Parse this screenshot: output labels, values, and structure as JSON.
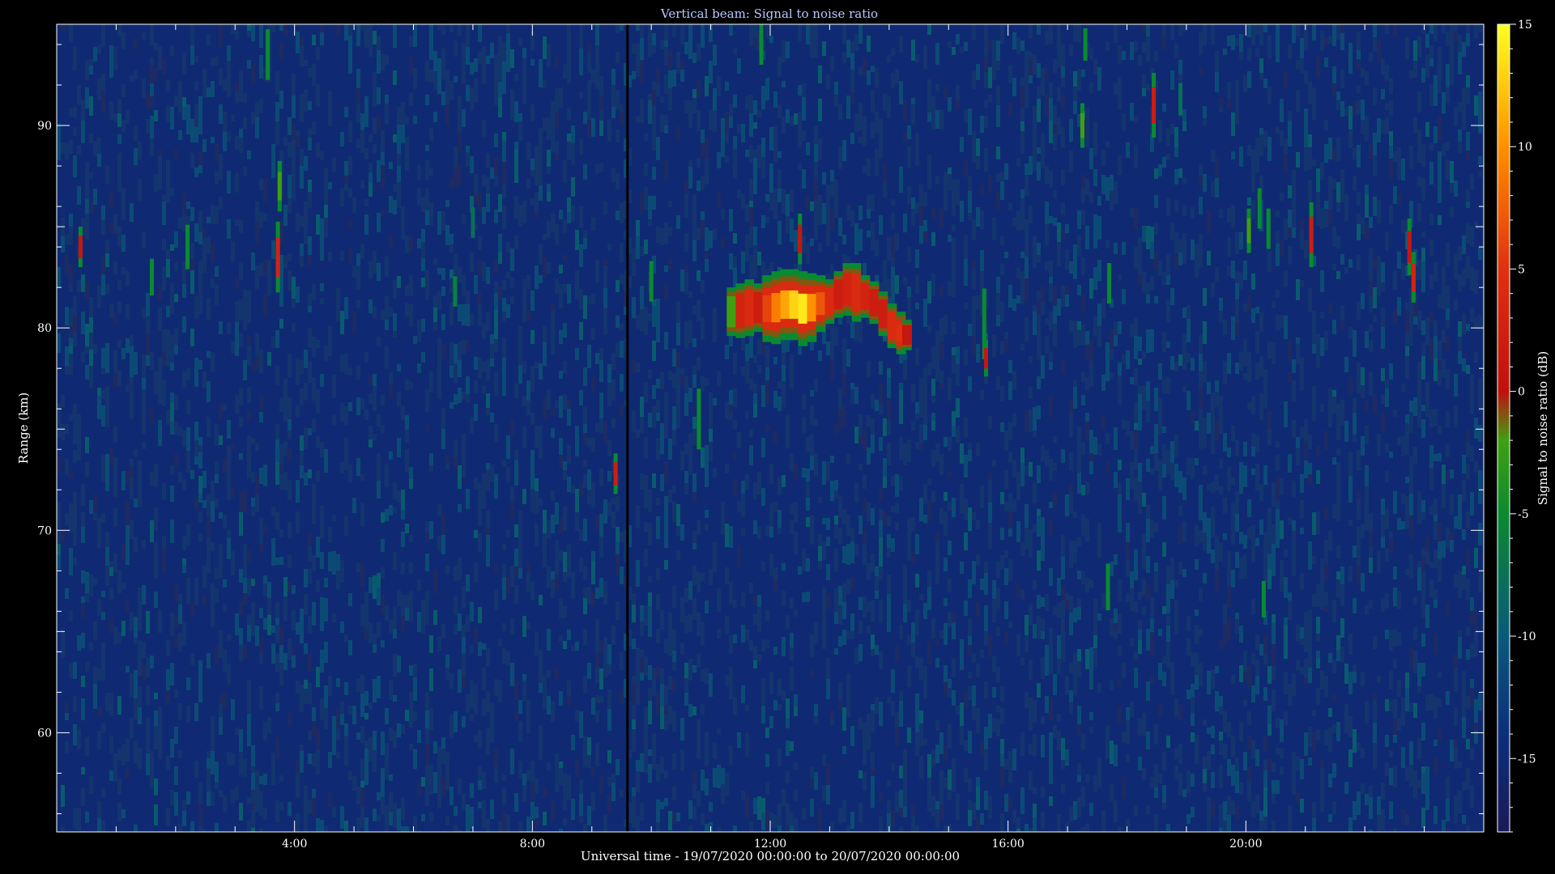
{
  "chart_data": {
    "type": "heatmap",
    "title": "Vertical beam: Signal to noise ratio",
    "xlabel": "Universal time - 19/07/2020 00:00:00 to 20/07/2020 00:00:00",
    "ylabel": "Range (km)",
    "colorbar_label": "Signal to noise ratio (dB)",
    "xlim_hours": [
      0,
      24
    ],
    "ylim_km": [
      55.1,
      95.0
    ],
    "x_ticks": [
      {
        "hour": 4,
        "label": "4:00"
      },
      {
        "hour": 8,
        "label": "8:00"
      },
      {
        "hour": 12,
        "label": "12:00"
      },
      {
        "hour": 16,
        "label": "16:00"
      },
      {
        "hour": 20,
        "label": "20:00"
      }
    ],
    "y_ticks": [
      {
        "km": 60,
        "label": "60"
      },
      {
        "km": 70,
        "label": "70"
      },
      {
        "km": 80,
        "label": "80"
      },
      {
        "km": 90,
        "label": "90"
      }
    ],
    "colorbar_range_db": [
      -18,
      15
    ],
    "colorbar_ticks": [
      {
        "db": 15,
        "label": "15"
      },
      {
        "db": 10,
        "label": "10"
      },
      {
        "db": 5,
        "label": "5"
      },
      {
        "db": 0,
        "label": "0"
      },
      {
        "db": -5,
        "label": "-5"
      },
      {
        "db": -10,
        "label": "-10"
      },
      {
        "db": -15,
        "label": "-15"
      }
    ],
    "colormap_stops": [
      {
        "db": -18,
        "color": "#1a1a5a"
      },
      {
        "db": -14,
        "color": "#0b2f7a"
      },
      {
        "db": -10,
        "color": "#0a5a7a"
      },
      {
        "db": -5,
        "color": "#0a8a30"
      },
      {
        "db": -2,
        "color": "#40a010"
      },
      {
        "db": 0,
        "color": "#c01010"
      },
      {
        "db": 5,
        "color": "#e03010"
      },
      {
        "db": 10,
        "color": "#ff9000"
      },
      {
        "db": 15,
        "color": "#ffff20"
      }
    ],
    "background_db": -15,
    "data_gap_hour": 9.6,
    "echoes": [
      {
        "hour": 0.4,
        "km": 84.0,
        "height_km": 2.0,
        "db": 1
      },
      {
        "hour": 2.2,
        "km": 84.0,
        "height_km": 2.2,
        "db": -5
      },
      {
        "hour": 1.6,
        "km": 82.5,
        "height_km": 1.8,
        "db": -5
      },
      {
        "hour": 3.55,
        "km": 93.5,
        "height_km": 2.5,
        "db": -5
      },
      {
        "hour": 3.75,
        "km": 87.0,
        "height_km": 2.5,
        "db": -2
      },
      {
        "hour": 3.72,
        "km": 83.5,
        "height_km": 3.5,
        "db": 3
      },
      {
        "hour": 6.7,
        "km": 81.8,
        "height_km": 1.5,
        "db": -6
      },
      {
        "hour": 7.0,
        "km": 85.2,
        "height_km": 1.5,
        "db": -8
      },
      {
        "hour": 9.4,
        "km": 72.8,
        "height_km": 2.0,
        "db": 2
      },
      {
        "hour": 10.0,
        "km": 82.3,
        "height_km": 2.0,
        "db": -5
      },
      {
        "hour": 10.8,
        "km": 75.5,
        "height_km": 3.0,
        "db": -5
      },
      {
        "hour": 11.85,
        "km": 94.0,
        "height_km": 2.0,
        "db": -5
      },
      {
        "hour": 12.5,
        "km": 84.4,
        "height_km": 2.5,
        "db": 1
      },
      {
        "hour": 15.6,
        "km": 80.2,
        "height_km": 3.5,
        "db": -5
      },
      {
        "hour": 15.63,
        "km": 78.5,
        "height_km": 1.8,
        "db": 1
      },
      {
        "hour": 17.3,
        "km": 94.0,
        "height_km": 1.6,
        "db": -5
      },
      {
        "hour": 17.25,
        "km": 90.0,
        "height_km": 2.2,
        "db": -2
      },
      {
        "hour": 17.7,
        "km": 82.2,
        "height_km": 2.0,
        "db": -5
      },
      {
        "hour": 17.68,
        "km": 67.2,
        "height_km": 2.3,
        "db": -5
      },
      {
        "hour": 18.45,
        "km": 91.0,
        "height_km": 3.2,
        "db": 2
      },
      {
        "hour": 18.9,
        "km": 91.3,
        "height_km": 1.6,
        "db": -8
      },
      {
        "hour": 20.05,
        "km": 84.8,
        "height_km": 2.2,
        "db": -2
      },
      {
        "hour": 20.23,
        "km": 85.9,
        "height_km": 2.0,
        "db": -5
      },
      {
        "hour": 20.38,
        "km": 84.9,
        "height_km": 2.0,
        "db": -5
      },
      {
        "hour": 20.3,
        "km": 66.6,
        "height_km": 1.8,
        "db": -5
      },
      {
        "hour": 21.1,
        "km": 84.6,
        "height_km": 3.2,
        "db": 2
      },
      {
        "hour": 22.75,
        "km": 84.0,
        "height_km": 2.8,
        "db": 1
      },
      {
        "hour": 22.82,
        "km": 82.5,
        "height_km": 2.5,
        "db": 3
      }
    ],
    "main_echo": [
      {
        "hour": 11.35,
        "km_low": 79.6,
        "km_high": 82.0,
        "db": -2
      },
      {
        "hour": 11.5,
        "km_low": 79.5,
        "km_high": 82.2,
        "db": 3
      },
      {
        "hour": 11.65,
        "km_low": 79.6,
        "km_high": 82.4,
        "db": 4
      },
      {
        "hour": 11.8,
        "km_low": 79.8,
        "km_high": 82.2,
        "db": 2
      },
      {
        "hour": 11.95,
        "km_low": 79.3,
        "km_high": 82.6,
        "db": 6
      },
      {
        "hour": 12.1,
        "km_low": 79.2,
        "km_high": 82.8,
        "db": 9
      },
      {
        "hour": 12.25,
        "km_low": 79.4,
        "km_high": 82.9,
        "db": 11
      },
      {
        "hour": 12.4,
        "km_low": 79.4,
        "km_high": 82.9,
        "db": 13
      },
      {
        "hour": 12.55,
        "km_low": 79.1,
        "km_high": 82.8,
        "db": 14
      },
      {
        "hour": 12.7,
        "km_low": 79.3,
        "km_high": 82.7,
        "db": 10
      },
      {
        "hour": 12.85,
        "km_low": 79.8,
        "km_high": 82.6,
        "db": 7
      },
      {
        "hour": 13.0,
        "km_low": 80.2,
        "km_high": 82.4,
        "db": 4
      },
      {
        "hour": 13.15,
        "km_low": 80.5,
        "km_high": 82.8,
        "db": 2
      },
      {
        "hour": 13.3,
        "km_low": 80.6,
        "km_high": 83.2,
        "db": 3
      },
      {
        "hour": 13.45,
        "km_low": 80.3,
        "km_high": 83.2,
        "db": 4
      },
      {
        "hour": 13.6,
        "km_low": 80.5,
        "km_high": 82.6,
        "db": 3
      },
      {
        "hour": 13.75,
        "km_low": 80.2,
        "km_high": 82.3,
        "db": 2
      },
      {
        "hour": 13.9,
        "km_low": 79.6,
        "km_high": 81.8,
        "db": 2
      },
      {
        "hour": 14.05,
        "km_low": 79.0,
        "km_high": 81.2,
        "db": 4
      },
      {
        "hour": 14.2,
        "km_low": 78.7,
        "km_high": 80.8,
        "db": 5
      },
      {
        "hour": 14.3,
        "km_low": 78.9,
        "km_high": 80.4,
        "db": 1
      }
    ]
  }
}
